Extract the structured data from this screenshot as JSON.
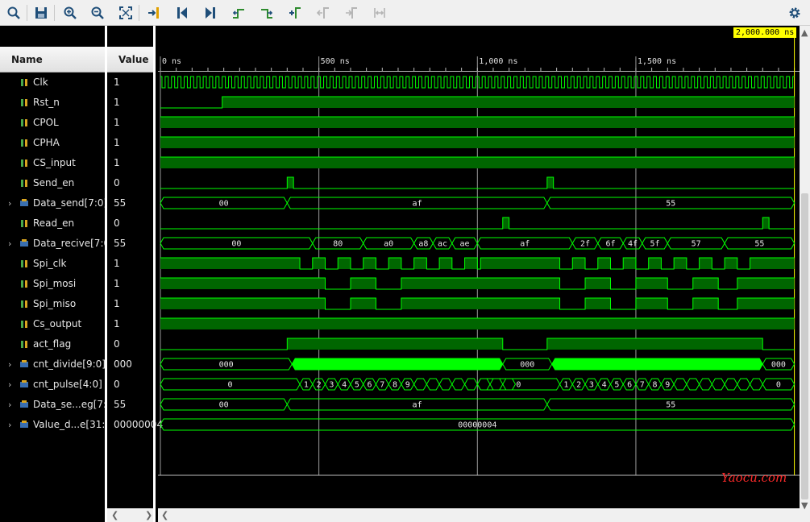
{
  "toolbar": {
    "buttons": [
      {
        "id": "search",
        "name": "search-icon"
      },
      {
        "id": "save",
        "name": "save-icon"
      },
      {
        "id": "zoom_in",
        "name": "zoom-in-icon"
      },
      {
        "id": "zoom_out",
        "name": "zoom-out-icon"
      },
      {
        "id": "zoom_fit",
        "name": "zoom-fit-icon"
      },
      {
        "id": "goto_cursor",
        "name": "go-to-cursor-icon"
      },
      {
        "id": "goto_start",
        "name": "go-to-start-icon"
      },
      {
        "id": "goto_end",
        "name": "go-to-end-icon"
      },
      {
        "id": "prev_transition",
        "name": "previous-transition-icon"
      },
      {
        "id": "next_transition",
        "name": "next-transition-icon"
      },
      {
        "id": "add_marker",
        "name": "add-marker-icon"
      },
      {
        "id": "prev_marker",
        "name": "previous-marker-icon"
      },
      {
        "id": "next_marker",
        "name": "next-marker-icon"
      },
      {
        "id": "swap_cursors",
        "name": "swap-cursors-icon"
      },
      {
        "id": "settings",
        "name": "gear-icon"
      }
    ]
  },
  "columns": {
    "name": "Name",
    "value": "Value"
  },
  "cursor_time": "2,000.000 ns",
  "time_axis": {
    "range_ns": [
      0,
      2000
    ],
    "ticks": [
      {
        "ns": 0,
        "label": "0 ns"
      },
      {
        "ns": 500,
        "label": "500 ns"
      },
      {
        "ns": 1000,
        "label": "1,000 ns"
      },
      {
        "ns": 1500,
        "label": "1,500 ns"
      }
    ]
  },
  "signals": [
    {
      "name": "Clk",
      "value": "1",
      "bus": false
    },
    {
      "name": "Rst_n",
      "value": "1",
      "bus": false
    },
    {
      "name": "CPOL",
      "value": "1",
      "bus": false
    },
    {
      "name": "CPHA",
      "value": "1",
      "bus": false
    },
    {
      "name": "CS_input",
      "value": "1",
      "bus": false
    },
    {
      "name": "Send_en",
      "value": "0",
      "bus": false
    },
    {
      "name": "Data_send[7:0]",
      "value": "55",
      "bus": true
    },
    {
      "name": "Read_en",
      "value": "0",
      "bus": false
    },
    {
      "name": "Data_recive[7:0]",
      "value": "55",
      "bus": true
    },
    {
      "name": "Spi_clk",
      "value": "1",
      "bus": false
    },
    {
      "name": "Spi_mosi",
      "value": "1",
      "bus": false
    },
    {
      "name": "Spi_miso",
      "value": "1",
      "bus": false
    },
    {
      "name": "Cs_output",
      "value": "1",
      "bus": false
    },
    {
      "name": "act_flag",
      "value": "0",
      "bus": false
    },
    {
      "name": "cnt_divide[9:0]",
      "value": "000",
      "bus": true
    },
    {
      "name": "cnt_pulse[4:0]",
      "value": "0",
      "bus": true
    },
    {
      "name": "Data_se...eg[7:0]",
      "value": "55",
      "bus": true
    },
    {
      "name": "Value_d...e[31:0]",
      "value": "00000004",
      "bus": true
    }
  ],
  "bus_labels": {
    "Data_send": [
      "00",
      "af",
      "55"
    ],
    "Data_recive": [
      "00",
      "80",
      "a0",
      "a8",
      "ac",
      "ae",
      "af",
      "2f",
      "6f",
      "4f",
      "5f",
      "57",
      "55"
    ],
    "cnt_divide": [
      "000",
      "000",
      "000"
    ],
    "cnt_pulse": [
      "0",
      "1",
      "2",
      "3",
      "4",
      "5",
      "6",
      "7",
      "8",
      "9",
      "0",
      "1",
      "2",
      "3",
      "4",
      "5",
      "6",
      "7",
      "8",
      "9",
      "0"
    ],
    "Data_se_eg": [
      "00",
      "af",
      "55"
    ],
    "Value_d_e": [
      "00000004"
    ]
  },
  "watermark": "Yaocu.com",
  "colors": {
    "wave": "#00ff00",
    "fill": "#006600",
    "busy": "#00ff00",
    "grid": "#5a5a5a",
    "cursor": "#ffff00"
  }
}
